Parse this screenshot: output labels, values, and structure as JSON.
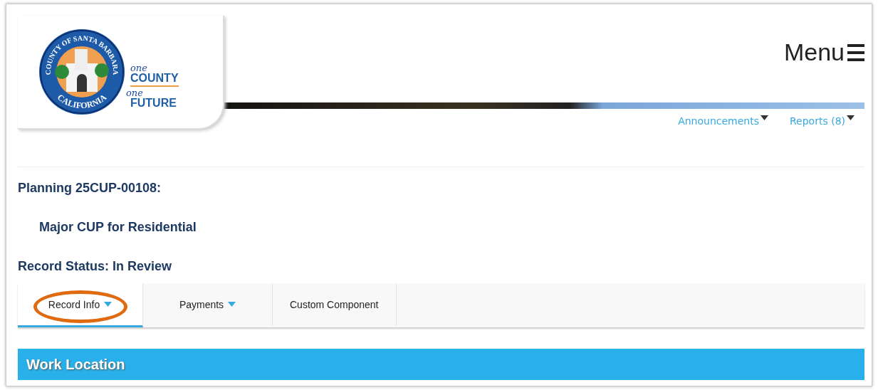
{
  "logo": {
    "seal_top": "COUNTY OF SANTA BARBARA",
    "seal_bottom": "CALIFORNIA",
    "tagline": [
      {
        "word": "one",
        "kind": "script"
      },
      {
        "word": "COUNTY",
        "kind": "caps"
      },
      {
        "word": "one",
        "kind": "script"
      },
      {
        "word": "FUTURE",
        "kind": "caps"
      }
    ]
  },
  "menu": {
    "label": "Menu"
  },
  "nav_links": [
    {
      "label": "Announcements"
    },
    {
      "label": "Reports (8)"
    }
  ],
  "record": {
    "title": "Planning 25CUP-00108:",
    "subtitle": "Major CUP for Residential",
    "status": "Record Status: In Review"
  },
  "tabs": [
    {
      "label": "Record Info",
      "selected": true,
      "dropdown": true,
      "highlighted": true
    },
    {
      "label": "Payments",
      "selected": false,
      "dropdown": true,
      "highlighted": false
    },
    {
      "label": "Custom Component",
      "selected": false,
      "dropdown": false,
      "highlighted": false
    }
  ],
  "section": {
    "title": "Work Location"
  }
}
